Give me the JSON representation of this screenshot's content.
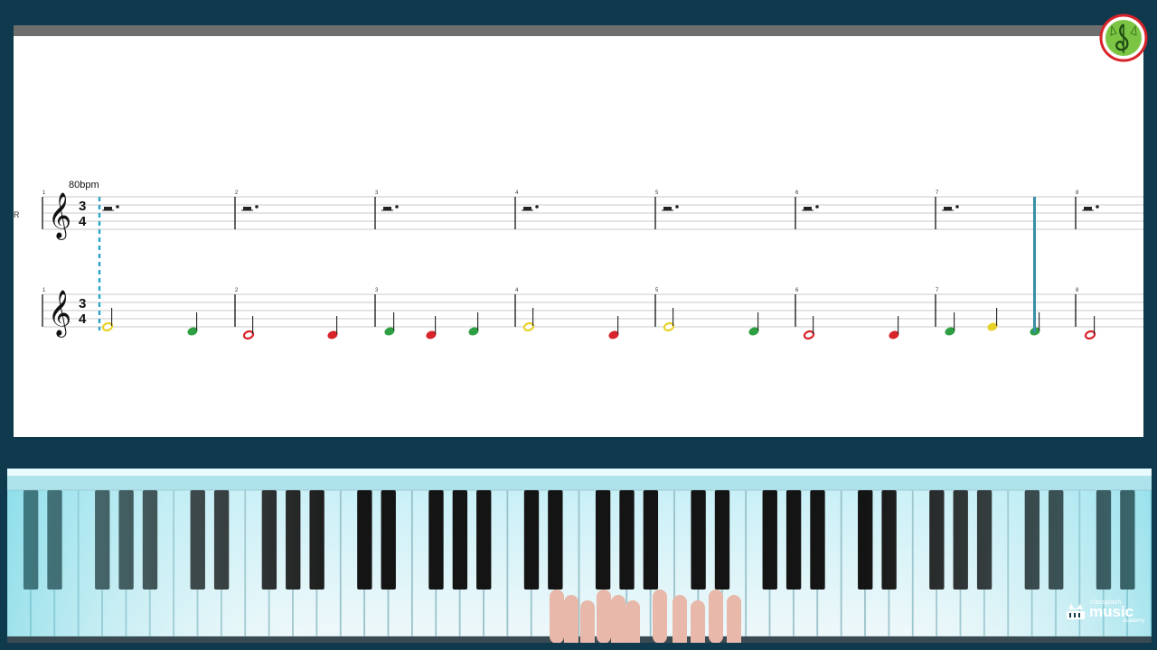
{
  "score": {
    "tempo_label": "80bpm",
    "time_signature": {
      "top": "3",
      "bottom": "4"
    },
    "upper_staff_label": "R",
    "measures": [
      "1",
      "2",
      "3",
      "4",
      "5",
      "6",
      "7",
      "8"
    ],
    "note_colors": {
      "green": "#2ea043",
      "red": "#d8232a",
      "yellow": "#e9d22a"
    },
    "lower_staff_notes": [
      {
        "measure": "1",
        "type": "half",
        "color": "yellow"
      },
      {
        "measure": "1",
        "type": "quarter",
        "color": "green"
      },
      {
        "measure": "2",
        "type": "half",
        "color": "red"
      },
      {
        "measure": "2",
        "type": "quarter",
        "color": "red"
      },
      {
        "measure": "3",
        "type": "quarter",
        "color": "green"
      },
      {
        "measure": "3",
        "type": "quarter",
        "color": "red"
      },
      {
        "measure": "3",
        "type": "quarter",
        "color": "green"
      },
      {
        "measure": "4",
        "type": "half",
        "color": "yellow"
      },
      {
        "measure": "4",
        "type": "quarter",
        "color": "red"
      },
      {
        "measure": "5",
        "type": "half",
        "color": "yellow"
      },
      {
        "measure": "5",
        "type": "quarter",
        "color": "green"
      },
      {
        "measure": "6",
        "type": "half",
        "color": "red"
      },
      {
        "measure": "6",
        "type": "quarter",
        "color": "red"
      },
      {
        "measure": "7",
        "type": "quarter",
        "color": "green"
      },
      {
        "measure": "7",
        "type": "quarter",
        "color": "yellow"
      },
      {
        "measure": "7",
        "type": "quarter",
        "color": "green"
      },
      {
        "measure": "8",
        "type": "half",
        "color": "red"
      }
    ],
    "playhead_color": "#3a8fa8",
    "cursor_color": "#2aa3c8"
  },
  "logo": {
    "icon": "classplash-treble-clef-cat-logo",
    "accent": "#d8232a",
    "fill": "#7cc544"
  },
  "piano": {
    "icon": "piano-keyboard",
    "glow_color": "#bfe9f2"
  },
  "brand": {
    "small": "classplash",
    "big": "music",
    "tiny": "academy",
    "icon": "piano-cat-icon"
  }
}
